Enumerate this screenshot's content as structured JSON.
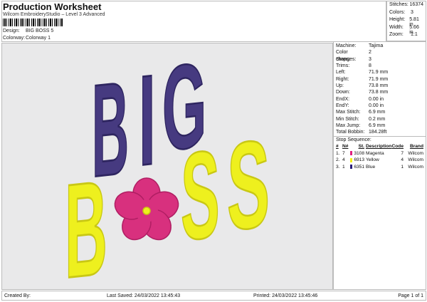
{
  "header": {
    "title": "Production Worksheet",
    "subtitle": "Wilcom EmbroideryStudio – Level 3 Advanced",
    "design_label": "Design:",
    "design_value": "BIG BOSS 5",
    "colorway_label": "Colorway:",
    "colorway_value": "Colorway 1"
  },
  "stats": [
    {
      "label": "Stitches:",
      "value": "16374"
    },
    {
      "label": "Colors:",
      "value": "3"
    },
    {
      "label": "Height:",
      "value": "5.81 in"
    },
    {
      "label": "Width:",
      "value": "5.66 in"
    },
    {
      "label": "Zoom:",
      "value": "1:1"
    }
  ],
  "details": [
    {
      "label": "Machine:",
      "value": "Tajima"
    },
    {
      "label": "Color changes:",
      "value": "2"
    },
    {
      "label": "Stops:",
      "value": "3"
    },
    {
      "label": "Trims:",
      "value": "8"
    },
    {
      "label": "Left:",
      "value": "71.9 mm"
    },
    {
      "label": "Right:",
      "value": "71.9 mm"
    },
    {
      "label": "Up:",
      "value": "73.8 mm"
    },
    {
      "label": "Down:",
      "value": "73.8 mm"
    },
    {
      "label": "EndX:",
      "value": "0.00 in"
    },
    {
      "label": "EndY:",
      "value": "0.00 in"
    },
    {
      "label": "Max Stitch:",
      "value": "6.9 mm"
    },
    {
      "label": "Min Stitch:",
      "value": "0.2 mm"
    },
    {
      "label": "Max Jump:",
      "value": "6.9 mm"
    },
    {
      "label": "Total Bobbin:",
      "value": "184.28ft"
    }
  ],
  "stop_sequence": {
    "title": "Stop Sequence:",
    "headers": [
      "#",
      "N#",
      "St.",
      "Description",
      "Code",
      "Brand"
    ],
    "rows": [
      {
        "num": "1.",
        "n": "7",
        "color": "#e0207f",
        "st": "3108",
        "desc": "Magenta",
        "code": "7",
        "brand": "Wilcom"
      },
      {
        "num": "2.",
        "n": "4",
        "color": "#f5f016",
        "st": "6913",
        "desc": "Yellow",
        "code": "4",
        "brand": "Wilcom"
      },
      {
        "num": "3.",
        "n": "1",
        "color": "#2a1f7a",
        "st": "6351",
        "desc": "Blue",
        "code": "1",
        "brand": "Wilcom"
      }
    ]
  },
  "design_artwork": {
    "line1": [
      "B",
      "I",
      "G"
    ],
    "line2": [
      "B",
      "S",
      "S"
    ],
    "colors": {
      "purple": "#463a80",
      "yellow": "#eef01e",
      "pink": "#d8307e"
    }
  },
  "footer": {
    "created_by": "Created By:",
    "last_saved": "Last Saved: 24/03/2022 13:45:43",
    "printed": "Printed: 24/03/2022 13:45:46",
    "page": "Page 1 of 1"
  }
}
